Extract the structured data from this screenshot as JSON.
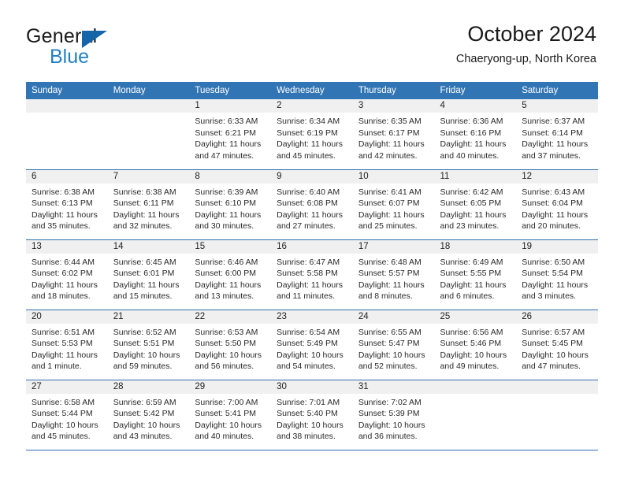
{
  "brand": {
    "name_part1": "General",
    "name_part2": "Blue",
    "logo_icon": "triangle-logo-icon"
  },
  "header": {
    "title": "October 2024",
    "subtitle": "Chaeryong-up, North Korea"
  },
  "colors": {
    "header_blue": "#3275b5",
    "row_rule_blue": "#2f6fae",
    "daynum_band": "#f0f0f0",
    "brand_blue": "#1f7fc4",
    "logo_blue": "#1565a8",
    "text": "#222222"
  },
  "weekday_headers": [
    "Sunday",
    "Monday",
    "Tuesday",
    "Wednesday",
    "Thursday",
    "Friday",
    "Saturday"
  ],
  "weeks": [
    [
      {
        "day": "",
        "lines": [
          "",
          "",
          "",
          ""
        ]
      },
      {
        "day": "",
        "lines": [
          "",
          "",
          "",
          ""
        ]
      },
      {
        "day": "1",
        "lines": [
          "Sunrise: 6:33 AM",
          "Sunset: 6:21 PM",
          "Daylight: 11 hours",
          "and 47 minutes."
        ]
      },
      {
        "day": "2",
        "lines": [
          "Sunrise: 6:34 AM",
          "Sunset: 6:19 PM",
          "Daylight: 11 hours",
          "and 45 minutes."
        ]
      },
      {
        "day": "3",
        "lines": [
          "Sunrise: 6:35 AM",
          "Sunset: 6:17 PM",
          "Daylight: 11 hours",
          "and 42 minutes."
        ]
      },
      {
        "day": "4",
        "lines": [
          "Sunrise: 6:36 AM",
          "Sunset: 6:16 PM",
          "Daylight: 11 hours",
          "and 40 minutes."
        ]
      },
      {
        "day": "5",
        "lines": [
          "Sunrise: 6:37 AM",
          "Sunset: 6:14 PM",
          "Daylight: 11 hours",
          "and 37 minutes."
        ]
      }
    ],
    [
      {
        "day": "6",
        "lines": [
          "Sunrise: 6:38 AM",
          "Sunset: 6:13 PM",
          "Daylight: 11 hours",
          "and 35 minutes."
        ]
      },
      {
        "day": "7",
        "lines": [
          "Sunrise: 6:38 AM",
          "Sunset: 6:11 PM",
          "Daylight: 11 hours",
          "and 32 minutes."
        ]
      },
      {
        "day": "8",
        "lines": [
          "Sunrise: 6:39 AM",
          "Sunset: 6:10 PM",
          "Daylight: 11 hours",
          "and 30 minutes."
        ]
      },
      {
        "day": "9",
        "lines": [
          "Sunrise: 6:40 AM",
          "Sunset: 6:08 PM",
          "Daylight: 11 hours",
          "and 27 minutes."
        ]
      },
      {
        "day": "10",
        "lines": [
          "Sunrise: 6:41 AM",
          "Sunset: 6:07 PM",
          "Daylight: 11 hours",
          "and 25 minutes."
        ]
      },
      {
        "day": "11",
        "lines": [
          "Sunrise: 6:42 AM",
          "Sunset: 6:05 PM",
          "Daylight: 11 hours",
          "and 23 minutes."
        ]
      },
      {
        "day": "12",
        "lines": [
          "Sunrise: 6:43 AM",
          "Sunset: 6:04 PM",
          "Daylight: 11 hours",
          "and 20 minutes."
        ]
      }
    ],
    [
      {
        "day": "13",
        "lines": [
          "Sunrise: 6:44 AM",
          "Sunset: 6:02 PM",
          "Daylight: 11 hours",
          "and 18 minutes."
        ]
      },
      {
        "day": "14",
        "lines": [
          "Sunrise: 6:45 AM",
          "Sunset: 6:01 PM",
          "Daylight: 11 hours",
          "and 15 minutes."
        ]
      },
      {
        "day": "15",
        "lines": [
          "Sunrise: 6:46 AM",
          "Sunset: 6:00 PM",
          "Daylight: 11 hours",
          "and 13 minutes."
        ]
      },
      {
        "day": "16",
        "lines": [
          "Sunrise: 6:47 AM",
          "Sunset: 5:58 PM",
          "Daylight: 11 hours",
          "and 11 minutes."
        ]
      },
      {
        "day": "17",
        "lines": [
          "Sunrise: 6:48 AM",
          "Sunset: 5:57 PM",
          "Daylight: 11 hours",
          "and 8 minutes."
        ]
      },
      {
        "day": "18",
        "lines": [
          "Sunrise: 6:49 AM",
          "Sunset: 5:55 PM",
          "Daylight: 11 hours",
          "and 6 minutes."
        ]
      },
      {
        "day": "19",
        "lines": [
          "Sunrise: 6:50 AM",
          "Sunset: 5:54 PM",
          "Daylight: 11 hours",
          "and 3 minutes."
        ]
      }
    ],
    [
      {
        "day": "20",
        "lines": [
          "Sunrise: 6:51 AM",
          "Sunset: 5:53 PM",
          "Daylight: 11 hours",
          "and 1 minute."
        ]
      },
      {
        "day": "21",
        "lines": [
          "Sunrise: 6:52 AM",
          "Sunset: 5:51 PM",
          "Daylight: 10 hours",
          "and 59 minutes."
        ]
      },
      {
        "day": "22",
        "lines": [
          "Sunrise: 6:53 AM",
          "Sunset: 5:50 PM",
          "Daylight: 10 hours",
          "and 56 minutes."
        ]
      },
      {
        "day": "23",
        "lines": [
          "Sunrise: 6:54 AM",
          "Sunset: 5:49 PM",
          "Daylight: 10 hours",
          "and 54 minutes."
        ]
      },
      {
        "day": "24",
        "lines": [
          "Sunrise: 6:55 AM",
          "Sunset: 5:47 PM",
          "Daylight: 10 hours",
          "and 52 minutes."
        ]
      },
      {
        "day": "25",
        "lines": [
          "Sunrise: 6:56 AM",
          "Sunset: 5:46 PM",
          "Daylight: 10 hours",
          "and 49 minutes."
        ]
      },
      {
        "day": "26",
        "lines": [
          "Sunrise: 6:57 AM",
          "Sunset: 5:45 PM",
          "Daylight: 10 hours",
          "and 47 minutes."
        ]
      }
    ],
    [
      {
        "day": "27",
        "lines": [
          "Sunrise: 6:58 AM",
          "Sunset: 5:44 PM",
          "Daylight: 10 hours",
          "and 45 minutes."
        ]
      },
      {
        "day": "28",
        "lines": [
          "Sunrise: 6:59 AM",
          "Sunset: 5:42 PM",
          "Daylight: 10 hours",
          "and 43 minutes."
        ]
      },
      {
        "day": "29",
        "lines": [
          "Sunrise: 7:00 AM",
          "Sunset: 5:41 PM",
          "Daylight: 10 hours",
          "and 40 minutes."
        ]
      },
      {
        "day": "30",
        "lines": [
          "Sunrise: 7:01 AM",
          "Sunset: 5:40 PM",
          "Daylight: 10 hours",
          "and 38 minutes."
        ]
      },
      {
        "day": "31",
        "lines": [
          "Sunrise: 7:02 AM",
          "Sunset: 5:39 PM",
          "Daylight: 10 hours",
          "and 36 minutes."
        ]
      },
      {
        "day": "",
        "lines": [
          "",
          "",
          "",
          ""
        ]
      },
      {
        "day": "",
        "lines": [
          "",
          "",
          "",
          ""
        ]
      }
    ]
  ]
}
